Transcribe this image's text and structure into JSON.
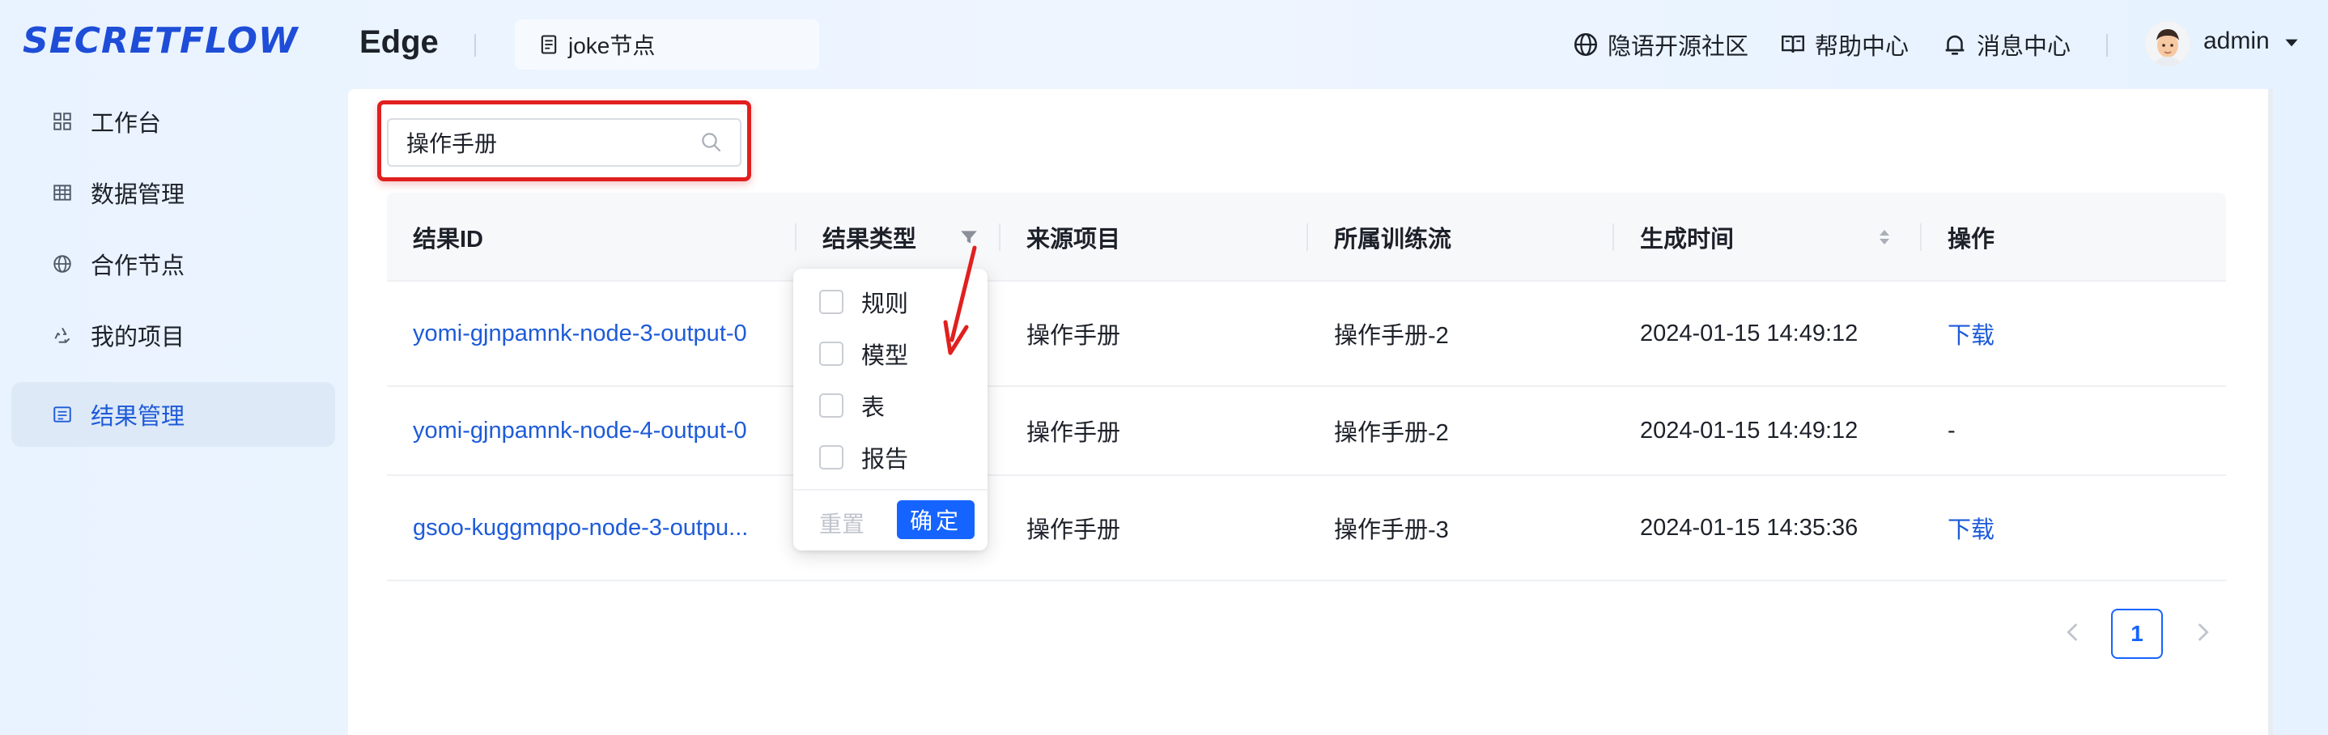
{
  "header": {
    "logo_text": "SECRETFLOW",
    "app_title": "Edge",
    "node_name": "joke节点",
    "links": [
      {
        "label": "隐语开源社区",
        "icon": "globe-icon"
      },
      {
        "label": "帮助中心",
        "icon": "book-icon"
      },
      {
        "label": "消息中心",
        "icon": "bell-icon"
      }
    ],
    "user_name": "admin"
  },
  "sidebar": {
    "items": [
      {
        "label": "工作台",
        "icon": "grid-icon",
        "active": false
      },
      {
        "label": "数据管理",
        "icon": "table-icon",
        "active": false
      },
      {
        "label": "合作节点",
        "icon": "globe-icon",
        "active": false
      },
      {
        "label": "我的项目",
        "icon": "recycle-icon",
        "active": false
      },
      {
        "label": "结果管理",
        "icon": "list-icon",
        "active": true
      }
    ]
  },
  "search": {
    "value": "操作手册"
  },
  "table": {
    "columns": [
      "结果ID",
      "结果类型",
      "来源项目",
      "所属训练流",
      "生成时间",
      "操作"
    ],
    "rows": [
      {
        "id": "yomi-gjnpamnk-node-3-output-0",
        "project": "操作手册",
        "flow": "操作手册-2",
        "time": "2024-01-15 14:49:12",
        "action": "下载"
      },
      {
        "id": "yomi-gjnpamnk-node-4-output-0",
        "project": "操作手册",
        "flow": "操作手册-2",
        "time": "2024-01-15 14:49:12",
        "action": "-"
      },
      {
        "id": "gsoo-kuggmqpo-node-3-outpu...",
        "project": "操作手册",
        "flow": "操作手册-3",
        "time": "2024-01-15 14:35:36",
        "action": "下载"
      }
    ]
  },
  "filter": {
    "options": [
      "规则",
      "模型",
      "表",
      "报告"
    ],
    "reset_label": "重置",
    "ok_label": "确定"
  },
  "pagination": {
    "current": "1"
  },
  "colors": {
    "accent": "#1664ff",
    "link": "#1e5bd8",
    "highlight": "#e0201f"
  }
}
